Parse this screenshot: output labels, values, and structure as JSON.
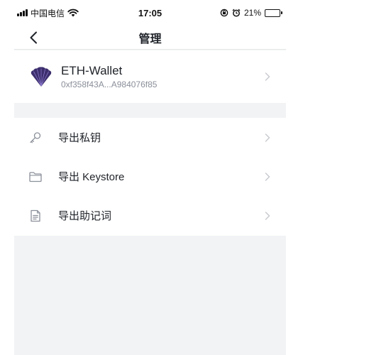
{
  "status_bar": {
    "carrier": "中国电信",
    "time": "17:05",
    "battery": "21%",
    "battery_level": 0.21
  },
  "nav": {
    "title": "管理",
    "back_icon": "chevron-left-icon"
  },
  "wallet": {
    "name": "ETH-Wallet",
    "address": "0xf358f43A...A984076f85",
    "logo_icon": "shell-fan-logo"
  },
  "menu": {
    "items": [
      {
        "label": "导出私钥",
        "icon": "key-icon"
      },
      {
        "label": "导出 Keystore",
        "icon": "folder-icon"
      },
      {
        "label": "导出助记词",
        "icon": "document-icon"
      }
    ]
  },
  "colors": {
    "page_background": "#f2f3f5",
    "card_background": "#ffffff",
    "primary_text": "#1f2329",
    "secondary_text": "#8a8f99",
    "logo_purple": "#3d2f6e"
  }
}
